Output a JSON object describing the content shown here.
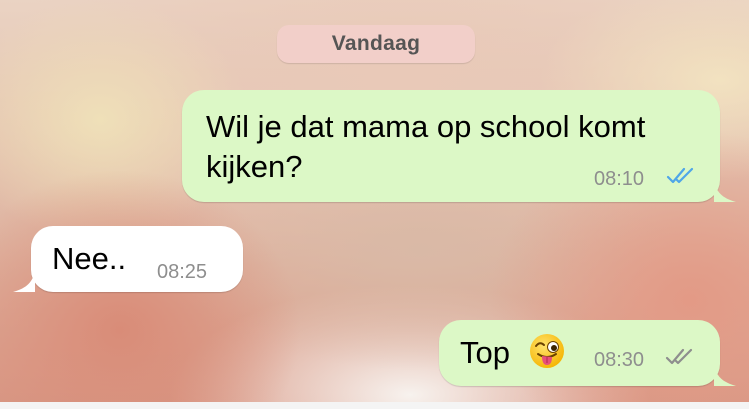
{
  "chat": {
    "date_separator": "Vandaag",
    "messages": [
      {
        "direction": "outgoing",
        "text": "Wil je dat mama op school komt kijken?",
        "time": "08:10",
        "status": "read",
        "status_color": "#4fa6e8"
      },
      {
        "direction": "incoming",
        "text": "Nee..",
        "time": "08:25"
      },
      {
        "direction": "outgoing",
        "text": "Top",
        "emoji": "winking-face-with-tongue",
        "time": "08:30",
        "status": "delivered",
        "status_color": "#8e8e8e"
      }
    ]
  },
  "colors": {
    "outgoing_bubble": "#dcf8c6",
    "incoming_bubble": "#ffffff",
    "date_pill": "#f2cfc9"
  }
}
